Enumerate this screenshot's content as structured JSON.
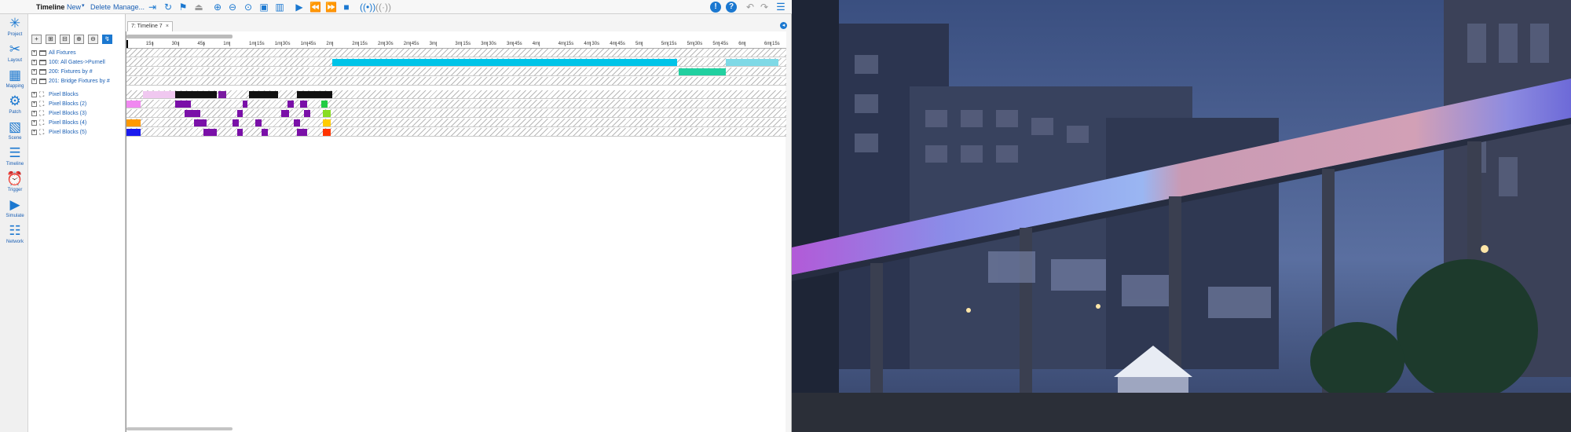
{
  "toolbar": {
    "title": "Timeline",
    "new_label": "New",
    "delete_label": "Delete",
    "manage_label": "Manage..."
  },
  "leftbar": {
    "items": [
      {
        "label": "Project",
        "icon": "star-icon"
      },
      {
        "label": "Layout",
        "icon": "tools-icon"
      },
      {
        "label": "Mapping",
        "icon": "grid-icon"
      },
      {
        "label": "Patch",
        "icon": "patch-icon"
      },
      {
        "label": "Scene",
        "icon": "scene-icon"
      },
      {
        "label": "Timeline",
        "icon": "timeline-icon"
      },
      {
        "label": "Trigger",
        "icon": "alarm-icon"
      },
      {
        "label": "Simulate",
        "icon": "play-icon"
      },
      {
        "label": "Network",
        "icon": "network-icon"
      }
    ]
  },
  "tree": {
    "rows": [
      {
        "label": "All Fixtures",
        "kind": "folder"
      },
      {
        "label": "100: All Gates->Purnell",
        "kind": "folder"
      },
      {
        "label": "200: Fixtures by #",
        "kind": "folder"
      },
      {
        "label": "201: Bridge Fixtures by #",
        "kind": "folder"
      },
      {
        "label": "Pixel Blocks",
        "kind": "pixel"
      },
      {
        "label": "Pixel Blocks (2)",
        "kind": "pixel"
      },
      {
        "label": "Pixel Blocks (3)",
        "kind": "pixel"
      },
      {
        "label": "Pixel Blocks (4)",
        "kind": "pixel"
      },
      {
        "label": "Pixel Blocks (5)",
        "kind": "pixel"
      }
    ]
  },
  "tab": {
    "label": "7: Timeline 7",
    "close": "×"
  },
  "ruler": {
    "labels": [
      "15s",
      "30s",
      "45s",
      "1m",
      "1m 15s",
      "1m 30s",
      "1m 45s",
      "2m",
      "2m 15s",
      "2m 30s",
      "2m 45s",
      "3m",
      "3m 15s",
      "3m 30s",
      "3m 45s",
      "4m",
      "4m 15s",
      "4m 30s",
      "4m 45s",
      "5m",
      "5m 15s",
      "5m 30s",
      "5m 45s",
      "6m",
      "6m 15s"
    ]
  },
  "lanes": [
    {
      "blocks": []
    },
    {
      "blocks": [
        {
          "start": 128,
          "end": 342,
          "color": "#00c4e8"
        },
        {
          "start": 372,
          "end": 405,
          "color": "#7fd9e6"
        }
      ]
    },
    {
      "blocks": [
        {
          "start": 343,
          "end": 372,
          "color": "#22d0a0"
        }
      ]
    },
    {
      "blocks": []
    },
    {
      "blocks": [
        {
          "start": 10,
          "end": 30,
          "color": "#f0c8f0"
        },
        {
          "start": 30,
          "end": 56,
          "color": "#111111"
        },
        {
          "start": 57,
          "end": 62,
          "color": "#7a1aa0"
        },
        {
          "start": 76,
          "end": 94,
          "color": "#111111"
        },
        {
          "start": 106,
          "end": 128,
          "color": "#111111"
        }
      ]
    },
    {
      "blocks": [
        {
          "start": 0,
          "end": 9,
          "color": "#f088f0"
        },
        {
          "start": 30,
          "end": 40,
          "color": "#7a10a8"
        },
        {
          "start": 72,
          "end": 75,
          "color": "#7a10a8"
        },
        {
          "start": 100,
          "end": 104,
          "color": "#7a10a8"
        },
        {
          "start": 108,
          "end": 112,
          "color": "#7a10a8"
        },
        {
          "start": 121,
          "end": 125,
          "color": "#22cc44"
        }
      ]
    },
    {
      "blocks": [
        {
          "start": 36,
          "end": 46,
          "color": "#7a10a8"
        },
        {
          "start": 69,
          "end": 72,
          "color": "#7a10a8"
        },
        {
          "start": 96,
          "end": 101,
          "color": "#7a10a8"
        },
        {
          "start": 110,
          "end": 114,
          "color": "#7a10a8"
        },
        {
          "start": 122,
          "end": 127,
          "color": "#88dd22"
        }
      ]
    },
    {
      "blocks": [
        {
          "start": 0,
          "end": 9,
          "color": "#ff9900"
        },
        {
          "start": 42,
          "end": 50,
          "color": "#7a10a8"
        },
        {
          "start": 66,
          "end": 70,
          "color": "#7a10a8"
        },
        {
          "start": 80,
          "end": 84,
          "color": "#7a10a8"
        },
        {
          "start": 104,
          "end": 108,
          "color": "#7a10a8"
        },
        {
          "start": 122,
          "end": 127,
          "color": "#ffcc00"
        }
      ]
    },
    {
      "blocks": [
        {
          "start": 0,
          "end": 9,
          "color": "#1a1aee"
        },
        {
          "start": 48,
          "end": 56,
          "color": "#7a10a8"
        },
        {
          "start": 69,
          "end": 72,
          "color": "#7a10a8"
        },
        {
          "start": 84,
          "end": 88,
          "color": "#7a10a8"
        },
        {
          "start": 106,
          "end": 112,
          "color": "#7a10a8"
        },
        {
          "start": 122,
          "end": 127,
          "color": "#ff3300"
        }
      ]
    }
  ]
}
